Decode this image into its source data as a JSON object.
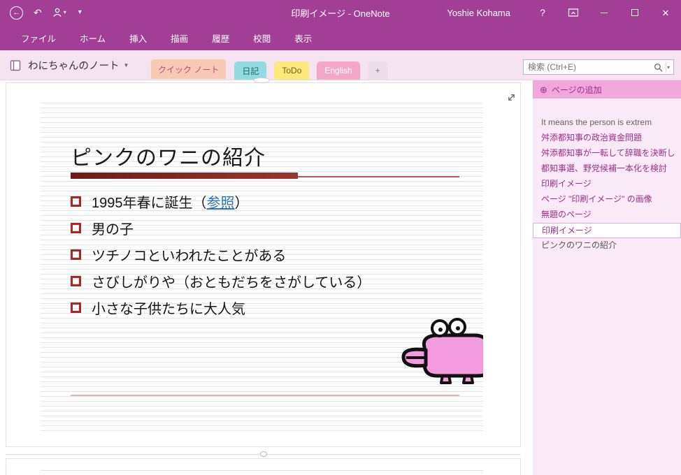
{
  "colors": {
    "titlebar_bg": "#a33e97",
    "bar_bg": "#f5e3f1",
    "sidebar_bg": "#faeaf7",
    "add_page_bg": "#f1a7db",
    "sidebar_text": "#9b2f88",
    "link_blue": "#2e74b5",
    "checkbox_red": "#be1e1e",
    "underline_red": "#8c2420",
    "croc_pink": "#f49ade"
  },
  "icons": {
    "back": "←",
    "undo": "↶",
    "user_dropdown": "▾",
    "qat_dropdown": "▾",
    "notebook_dropdown": "▼",
    "search_dropdown": "▾",
    "add_circle": "⊕",
    "help": "?",
    "close": "×"
  },
  "titlebar": {
    "title": "印刷イメージ - OneNote",
    "user_name": "Yoshie Kohama"
  },
  "ribbon": {
    "tabs": [
      {
        "label": "ファイル"
      },
      {
        "label": "ホーム"
      },
      {
        "label": "挿入"
      },
      {
        "label": "描画"
      },
      {
        "label": "履歴"
      },
      {
        "label": "校閲"
      },
      {
        "label": "表示"
      }
    ]
  },
  "notebook_bar": {
    "notebook_name": "わにちゃんのノート",
    "sections": [
      {
        "label": "クイック ノート",
        "bg": "#f8c9b4",
        "text": "#b94a7e",
        "active": true
      },
      {
        "label": "日記",
        "bg": "#92dce1",
        "text": "#1f6468",
        "active": false
      },
      {
        "label": "ToDo",
        "bg": "#fce97a",
        "text": "#6d5b1e",
        "active": false
      },
      {
        "label": "English",
        "bg": "#f2a6c8",
        "text": "#ffffff",
        "active": false
      },
      {
        "label": "+",
        "bg": "#ecdfe9",
        "text": "#8a7385",
        "active": false
      }
    ],
    "search": {
      "placeholder": "検索 (Ctrl+E)"
    }
  },
  "sidebar": {
    "add_page_label": "ページの追加",
    "pages": [
      {
        "label": "It means the person is extrem",
        "color": "#6b625c",
        "selected": false
      },
      {
        "label": "舛添都知事の政治資金問題",
        "color": "#9b2f88",
        "selected": false
      },
      {
        "label": "舛添都知事が一転して辞職を決断し",
        "color": "#9b2f88",
        "selected": false
      },
      {
        "label": "都知事選、野党候補一本化を検討",
        "color": "#9b2f88",
        "selected": false
      },
      {
        "label": "印刷イメージ",
        "color": "#9b2f88",
        "selected": false
      },
      {
        "label": "ページ \"印刷イメージ\" の画像",
        "color": "#9b2f88",
        "selected": false
      },
      {
        "label": "無題のページ",
        "color": "#9b2f88",
        "selected": false
      },
      {
        "label": "印刷イメージ",
        "color": "#9b2f88",
        "selected": true
      },
      {
        "label": "ピンクのワニの紹介",
        "color": "#555555",
        "selected": false
      }
    ]
  },
  "page": {
    "title": "ピンクのワニの紹介",
    "bullets": [
      {
        "pre": "1995年春に誕生（",
        "link": "参照",
        "post": "）"
      },
      {
        "pre": "男の子"
      },
      {
        "pre": "ツチノコといわれたことがある"
      },
      {
        "pre": "さびしがりや（おともだちをさがしている）"
      },
      {
        "pre": "小さな子供たちに大人気"
      }
    ]
  }
}
